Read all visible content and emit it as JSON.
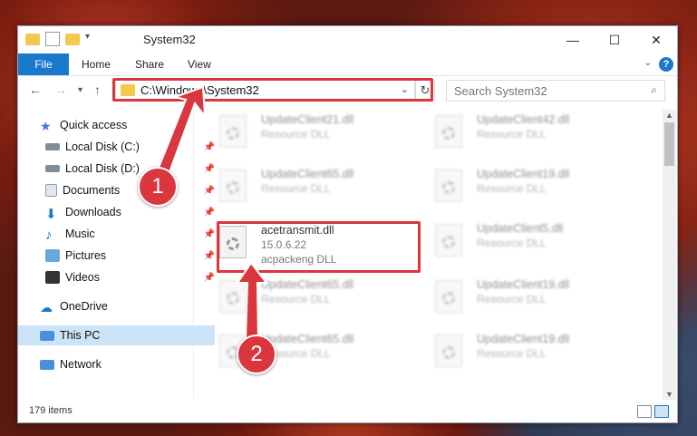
{
  "window": {
    "title": "System32",
    "controls": {
      "minimize": "—",
      "maximize": "☐",
      "close": "✕"
    }
  },
  "ribbon": {
    "tabs": [
      "File",
      "Home",
      "Share",
      "View"
    ]
  },
  "navigation": {
    "address": "C:\\Windows\\System32",
    "search_placeholder": "Search System32"
  },
  "sidebar": {
    "items": [
      {
        "label": "Quick access",
        "icon": "star-icon"
      },
      {
        "label": "Local Disk (C:)",
        "icon": "drive-icon",
        "pinned": true
      },
      {
        "label": "Local Disk (D:)",
        "icon": "drive-icon",
        "pinned": true
      },
      {
        "label": "Documents",
        "icon": "documents-icon",
        "pinned": true
      },
      {
        "label": "Downloads",
        "icon": "download-icon",
        "pinned": true
      },
      {
        "label": "Music",
        "icon": "music-icon",
        "pinned": true
      },
      {
        "label": "Pictures",
        "icon": "pictures-icon",
        "pinned": true
      },
      {
        "label": "Videos",
        "icon": "videos-icon",
        "pinned": true
      },
      {
        "label": "OneDrive",
        "icon": "cloud-icon"
      },
      {
        "label": "This PC",
        "icon": "computer-icon",
        "selected": true
      },
      {
        "label": "Network",
        "icon": "network-icon"
      }
    ]
  },
  "files": {
    "left": [
      {
        "name": "UpdateClient21.dll",
        "type": "Resource DLL"
      },
      {
        "name": "UpdateClient65.dll",
        "type": "Resource DLL"
      },
      {
        "name": "acetransmit.dll",
        "version": "15.0.6.22",
        "type": "acpackeng DLL"
      },
      {
        "name": "UpdateClient65.dll",
        "type": "Resource DLL"
      },
      {
        "name": "UpdateClient65.dll",
        "type": "Resource DLL"
      }
    ],
    "right": [
      {
        "name": "UpdateClient42.dll",
        "type": "Resource DLL"
      },
      {
        "name": "UpdateClient19.dll",
        "type": "Resource DLL"
      },
      {
        "name": "UpdateClient5.dll",
        "type": "Resource DLL"
      },
      {
        "name": "UpdateClient19.dll",
        "type": "Resource DLL"
      },
      {
        "name": "UpdateClient19.dll",
        "type": "Resource DLL"
      }
    ]
  },
  "status": {
    "count": "179 items"
  },
  "callouts": [
    "1",
    "2"
  ],
  "colors": {
    "accent": "#1979ca",
    "highlight": "#d9363e",
    "selected": "#cce4f7"
  }
}
